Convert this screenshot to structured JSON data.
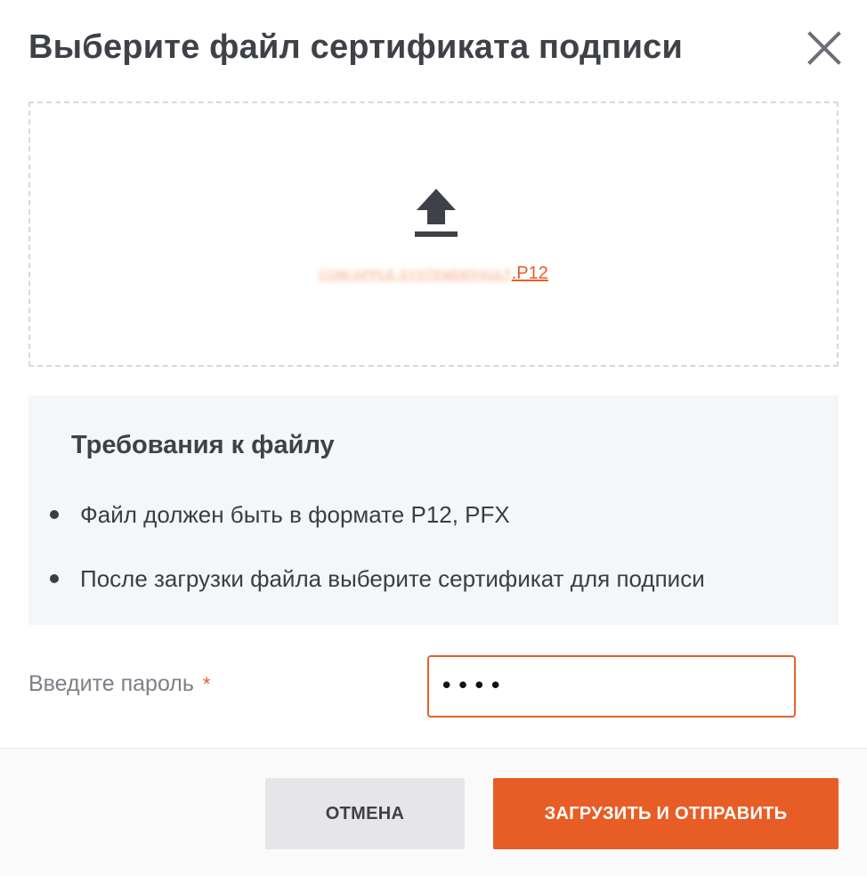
{
  "dialog": {
    "title": "Выберите файл сертификата подписи",
    "close_icon": "close-icon"
  },
  "dropzone": {
    "icon": "upload-icon",
    "file_name_obscured": "COM.APPLE.SYSTEMDEFAULT",
    "file_extension": ".P12"
  },
  "requirements": {
    "title": "Требования к файлу",
    "items": [
      "Файл должен быть в формате P12, PFX",
      "После загрузки файла выберите сертификат для подписи"
    ]
  },
  "password": {
    "label": "Введите пароль",
    "required_mark": "*",
    "value": "••••"
  },
  "buttons": {
    "cancel": "ОТМЕНА",
    "submit": "ЗАГРУЗИТЬ И ОТПРАВИТЬ"
  },
  "colors": {
    "accent": "#e85d26",
    "requirements_bg": "#f5f6f8",
    "cancel_bg": "#e6e6e8"
  }
}
